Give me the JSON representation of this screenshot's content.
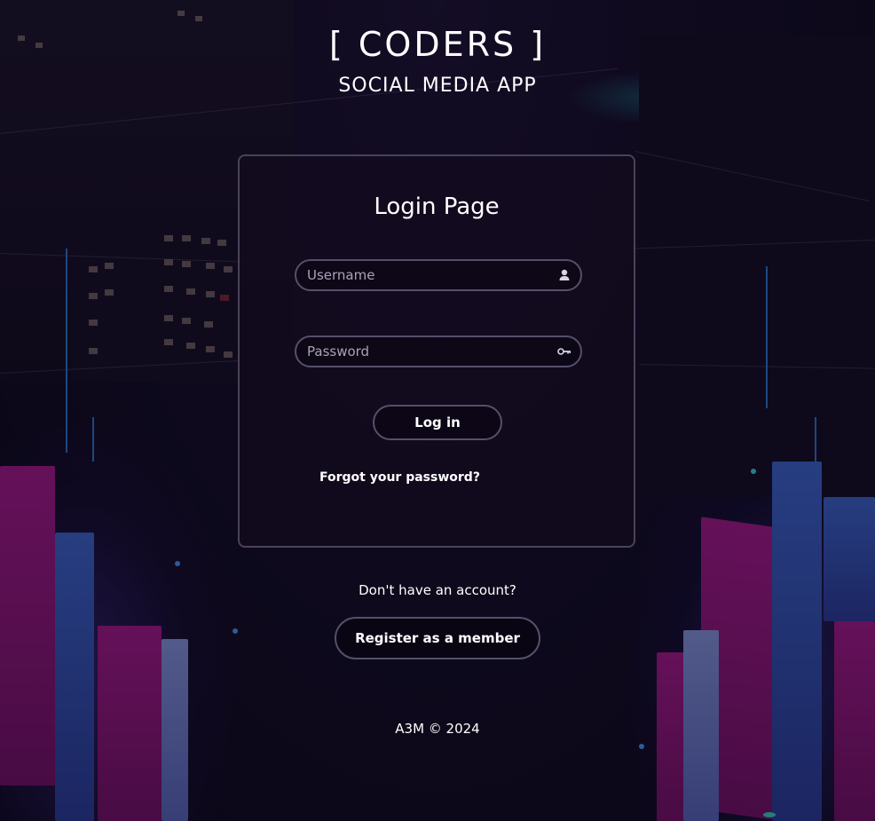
{
  "header": {
    "brand": "[ CODERS ]",
    "subtitle": "SOCIAL MEDIA APP"
  },
  "login": {
    "title": "Login Page",
    "username_placeholder": "Username",
    "username_value": "",
    "password_placeholder": "Password",
    "password_value": "",
    "username_icon": "user-icon",
    "password_icon": "key-icon",
    "login_label": "Log in",
    "forgot_label": "Forgot your password?"
  },
  "register": {
    "prompt": "Don't have an account?",
    "button_label": "Register as a member"
  },
  "footer": {
    "copyright": "A3M © 2024"
  },
  "colors": {
    "background": "#0f0a1c",
    "card_background": "#120a1e",
    "card_border": "#4a4357",
    "input_border": "#55506a",
    "text": "#ffffff",
    "placeholder": "#a8a3b8",
    "banner_magenta": "#b01a8f",
    "banner_blue": "#3d6bd6"
  }
}
